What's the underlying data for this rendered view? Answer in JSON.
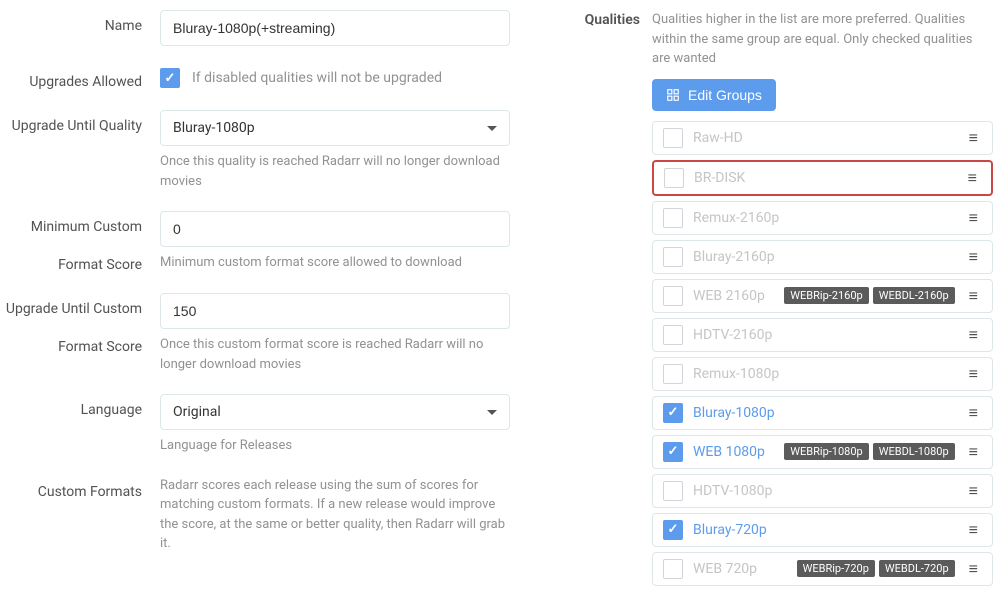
{
  "form": {
    "name_label": "Name",
    "name_value": "Bluray-1080p(+streaming)",
    "upgrades_label": "Upgrades Allowed",
    "upgrades_checked": true,
    "upgrades_help": "If disabled qualities will not be upgraded",
    "upgrade_until_label": "Upgrade Until Quality",
    "upgrade_until_value": "Bluray-1080p",
    "upgrade_until_help": "Once this quality is reached Radarr will no longer download movies",
    "min_custom_label1": "Minimum Custom",
    "min_custom_label2": "Format Score",
    "min_custom_value": "0",
    "min_custom_help": "Minimum custom format score allowed to download",
    "upgrade_custom_label1": "Upgrade Until Custom",
    "upgrade_custom_label2": "Format Score",
    "upgrade_custom_value": "150",
    "upgrade_custom_help": "Once this custom format score is reached Radarr will no longer download movies",
    "language_label": "Language",
    "language_value": "Original",
    "language_help": "Language for Releases",
    "custom_formats_label": "Custom Formats",
    "custom_formats_help": "Radarr scores each release using the sum of scores for matching custom formats. If a new release would improve the score, at the same or better quality, then Radarr will grab it."
  },
  "qualities": {
    "label": "Qualities",
    "description": "Qualities higher in the list are more preferred. Qualities within the same group are equal. Only checked qualities are wanted",
    "edit_button": "Edit Groups",
    "items": [
      {
        "name": "Raw-HD",
        "checked": false,
        "highlighted": false,
        "badges": []
      },
      {
        "name": "BR-DISK",
        "checked": false,
        "highlighted": true,
        "badges": []
      },
      {
        "name": "Remux-2160p",
        "checked": false,
        "highlighted": false,
        "badges": []
      },
      {
        "name": "Bluray-2160p",
        "checked": false,
        "highlighted": false,
        "badges": []
      },
      {
        "name": "WEB 2160p",
        "checked": false,
        "highlighted": false,
        "badges": [
          "WEBRip-2160p",
          "WEBDL-2160p"
        ]
      },
      {
        "name": "HDTV-2160p",
        "checked": false,
        "highlighted": false,
        "badges": []
      },
      {
        "name": "Remux-1080p",
        "checked": false,
        "highlighted": false,
        "badges": []
      },
      {
        "name": "Bluray-1080p",
        "checked": true,
        "highlighted": false,
        "badges": []
      },
      {
        "name": "WEB 1080p",
        "checked": true,
        "highlighted": false,
        "badges": [
          "WEBRip-1080p",
          "WEBDL-1080p"
        ]
      },
      {
        "name": "HDTV-1080p",
        "checked": false,
        "highlighted": false,
        "badges": []
      },
      {
        "name": "Bluray-720p",
        "checked": true,
        "highlighted": false,
        "badges": []
      },
      {
        "name": "WEB 720p",
        "checked": false,
        "highlighted": false,
        "badges": [
          "WEBRip-720p",
          "WEBDL-720p"
        ]
      }
    ]
  }
}
